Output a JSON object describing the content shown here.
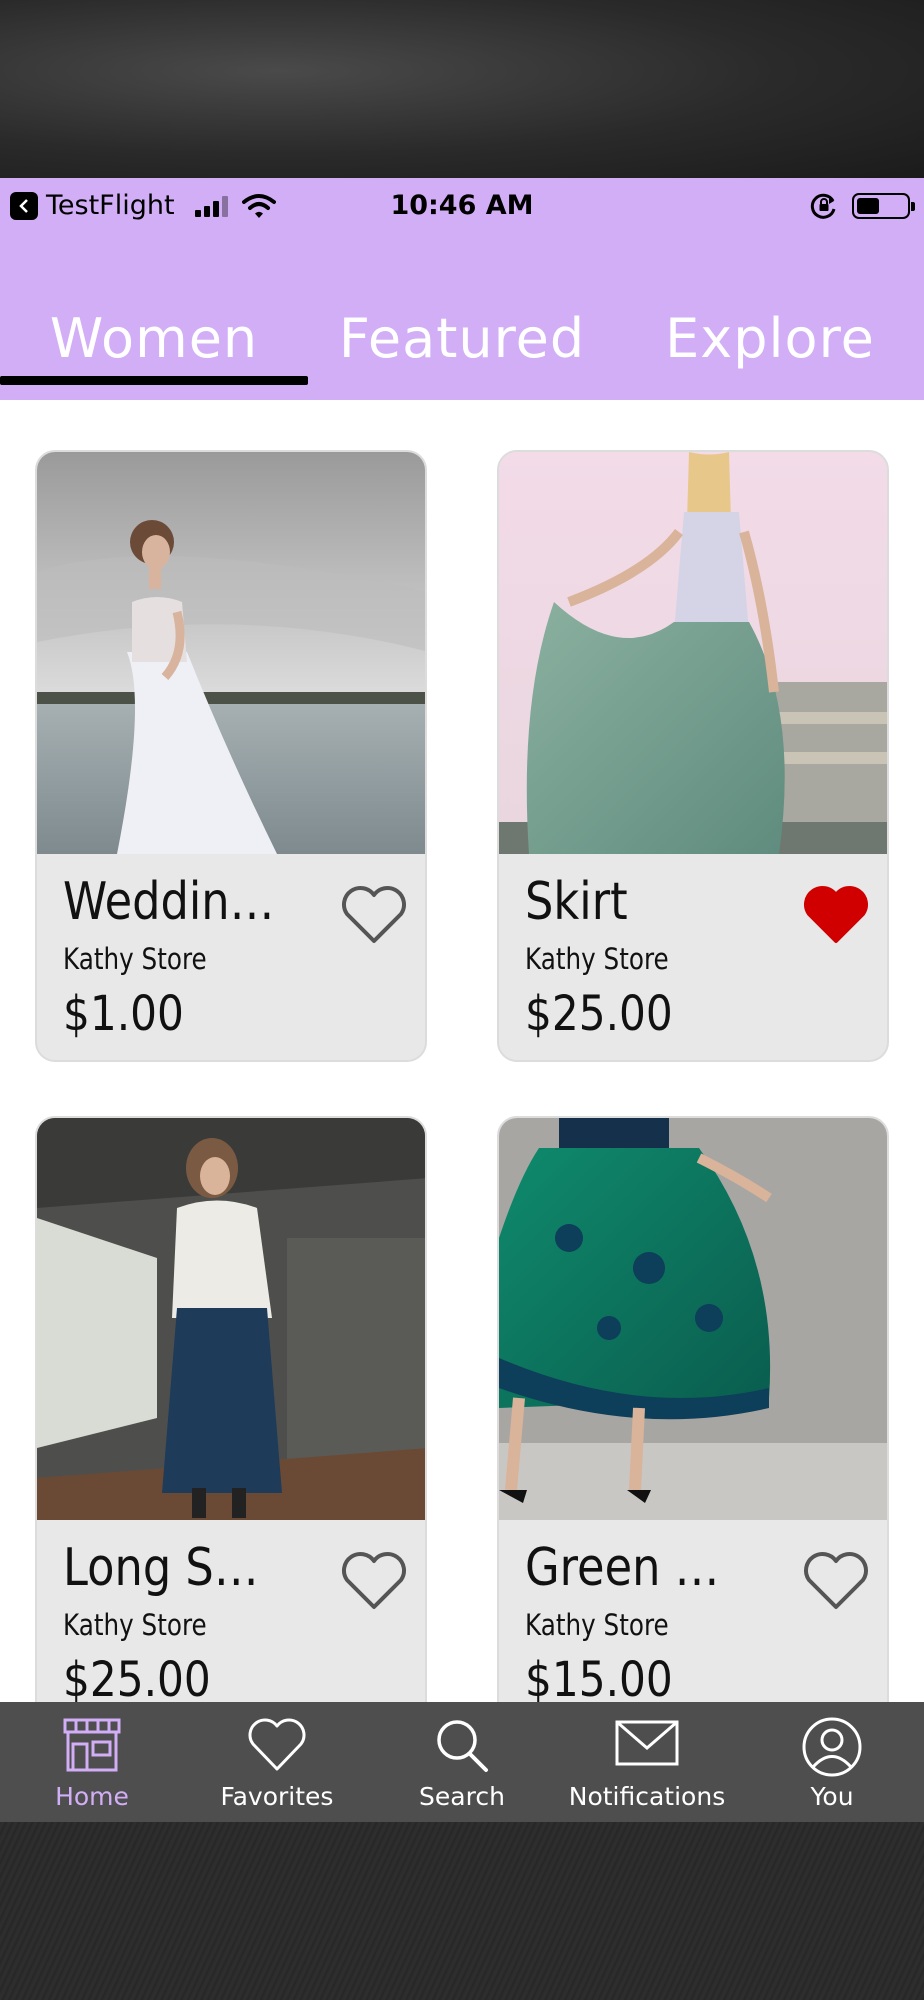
{
  "status_bar": {
    "back_app": "TestFlight",
    "time": "10:46 AM",
    "icons": [
      "back-icon",
      "signal-icon",
      "wifi-icon",
      "rotation-lock-icon",
      "battery-icon"
    ]
  },
  "tabs": [
    {
      "label": "Women",
      "selected": true
    },
    {
      "label": "Featured",
      "selected": false
    },
    {
      "label": "Explore",
      "selected": false
    }
  ],
  "colors": {
    "accent": "#d1aef5",
    "card_bg": "#e8e8e8",
    "tabbar_bg": "#4e4e4e",
    "favorite_red": "#d10000"
  },
  "products": [
    {
      "title": "Wedding…",
      "store": "Kathy Store",
      "price": "$1.00",
      "favorited": false,
      "image": "bride-in-white-dress-by-sea"
    },
    {
      "title": "Skirt",
      "store": "Kathy Store",
      "price": "$25.00",
      "favorited": true,
      "image": "woman-in-sage-green-maxi-skirt"
    },
    {
      "title": "Long Skirt",
      "store": "Kathy Store",
      "price": "$25.00",
      "favorited": false,
      "image": "woman-in-navy-pleated-skirt"
    },
    {
      "title": "Green skirt",
      "store": "Kathy Store",
      "price": "$15.00",
      "favorited": false,
      "image": "green-printed-satin-skirt"
    }
  ],
  "tabbar": [
    {
      "label": "Home",
      "icon": "storefront-icon",
      "active": true
    },
    {
      "label": "Favorites",
      "icon": "heart-icon",
      "active": false
    },
    {
      "label": "Search",
      "icon": "search-icon",
      "active": false
    },
    {
      "label": "Notifications",
      "icon": "envelope-icon",
      "active": false
    },
    {
      "label": "You",
      "icon": "user-icon",
      "active": false
    }
  ]
}
